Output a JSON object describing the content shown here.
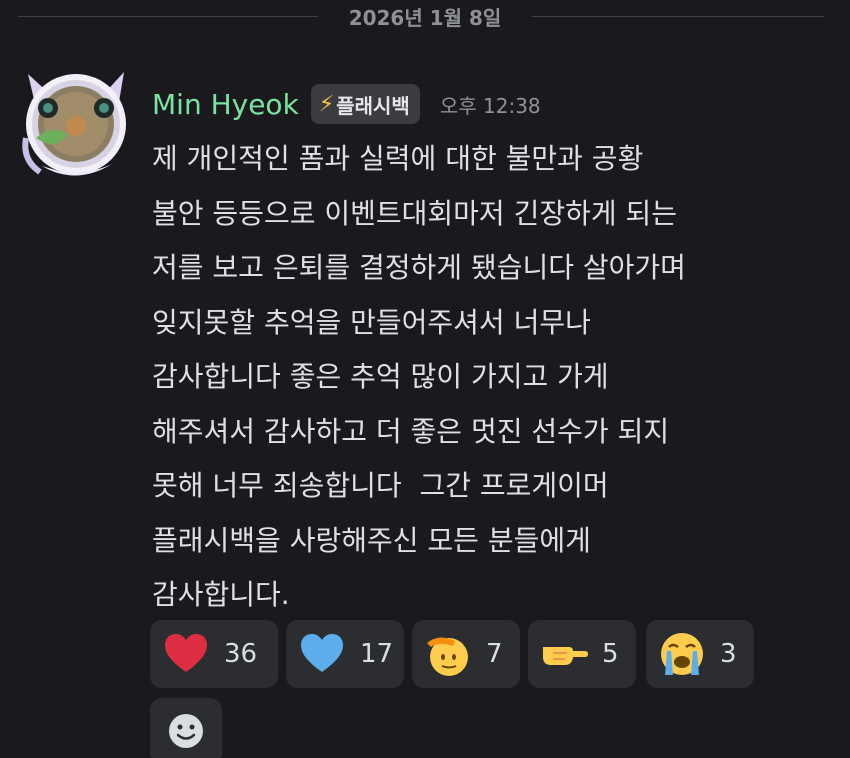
{
  "divider": {
    "date": "2026년 1월 8일"
  },
  "message": {
    "author": "Min Hyeok",
    "tag": "플래시백",
    "tag_icon": "lightning-bolt-icon",
    "timestamp": "오후 12:38",
    "lines": [
      "제 개인적인 폼과 실력에 대한 불만과 공황",
      "불안 등등으로 이벤트대회마저 긴장하게 되는",
      "저를 보고 은퇴를 결정하게 됐습니다 살아가며",
      "잊지못할 추억을 만들어주셔서 너무나",
      "감사합니다 좋은 추억 많이 가지고 가게",
      "해주셔서 감사하고 더 좋은 멋진 선수가 되지",
      "못해 너무 죄송합니다  그간 프로게이머",
      "플래시백을 사랑해주신 모든 분들에게",
      "감사합니다."
    ]
  },
  "reactions": [
    {
      "icon": "red-heart-icon",
      "count": "36"
    },
    {
      "icon": "blue-heart-icon",
      "count": "17"
    },
    {
      "icon": "saluting-face-icon",
      "count": "7"
    },
    {
      "icon": "pointing-hand-icon",
      "count": "5"
    },
    {
      "icon": "loudly-crying-face-icon",
      "count": "3"
    }
  ],
  "add_reaction": {
    "icon": "add-reaction-smiley-icon"
  },
  "colors": {
    "background": "#1a1a1e",
    "username": "#7be3a0",
    "reaction_bg": "#2b2d31",
    "tag_bg": "#3a3c42"
  }
}
